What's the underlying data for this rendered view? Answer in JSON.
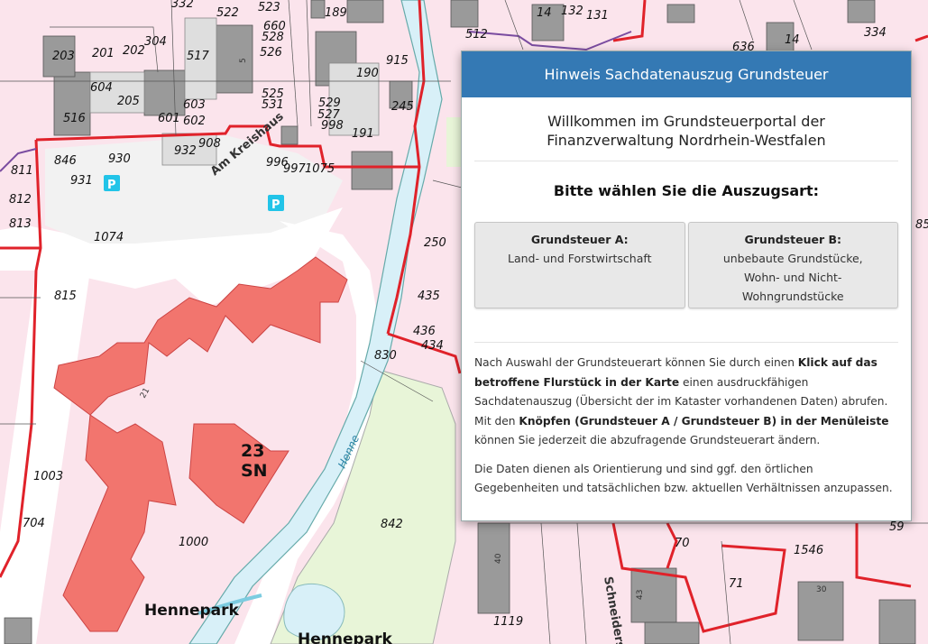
{
  "dialog": {
    "title": "Hinweis Sachdatenauszug Grundsteuer",
    "welcome_line1": "Willkommen im Grundsteuerportal der",
    "welcome_line2": "Finanzverwaltung Nordrhein-Westfalen",
    "prompt": "Bitte wählen Sie die Auszugsart:",
    "button_a": {
      "title": "Grundsteuer A:",
      "line1": "Land- und Forstwirtschaft"
    },
    "button_b": {
      "title": "Grundsteuer B:",
      "line1": "unbebaute Grundstücke,",
      "line2": "Wohn- und Nicht-",
      "line3": "Wohngrundstücke"
    },
    "info1": {
      "t1": "Nach Auswahl der Grundsteuerart können Sie durch einen ",
      "b1": "Klick auf das betroffene Flurstück in der Karte",
      "t2": " einen ausdruckfähigen Sachdatenauszug (Übersicht der im Kataster vorhandenen Daten) abrufen. Mit den ",
      "b2": "Knöpfen (Grundsteuer A / Grundsteuer B) in der Menüleiste",
      "t3": " können Sie jederzeit die abzufragende Grundsteuerart ändern."
    },
    "info2": "Die Daten dienen als Orientierung und sind ggf. den örtlichen Gegebenheiten und tatsächlichen bzw. aktuellen Verhältnissen anzupassen."
  },
  "map": {
    "colors": {
      "parcel_fill": "#fbe4ec",
      "boundary_red": "#e0222a",
      "building_gray": "#9a9a9a",
      "building_highlight": "#f2756e",
      "park_green": "#e8f5d8",
      "water": "#d8f0f8",
      "parking": "#22c4e8"
    },
    "parcel_numbers": [
      "332",
      "522",
      "523",
      "189",
      "14",
      "132",
      "131",
      "334",
      "636",
      "14",
      "660",
      "528",
      "526",
      "517",
      "915",
      "512",
      "304",
      "201",
      "202",
      "203",
      "604",
      "205",
      "190",
      "603",
      "525",
      "531",
      "529",
      "527",
      "245",
      "516",
      "601",
      "602",
      "998",
      "191",
      "908",
      "932",
      "846",
      "930",
      "996",
      "997",
      "1075",
      "811",
      "931",
      "812",
      "813",
      "1074",
      "250",
      "815",
      "435",
      "436",
      "434",
      "830",
      "1003",
      "704",
      "1000",
      "842",
      "1119",
      "70",
      "1546",
      "71",
      "59",
      "85"
    ],
    "building_numbers": [
      "23",
      "5",
      "21",
      "40",
      "43",
      "30"
    ],
    "labels": {
      "street_am_kreishaus": "Am Kreishaus",
      "street_schneider": "Schneiderstr.",
      "water_henne": "Henne",
      "park1": "Hennepark",
      "park2": "Hennepark",
      "district_num": "23",
      "district_code": "SN",
      "parking": "P"
    }
  }
}
